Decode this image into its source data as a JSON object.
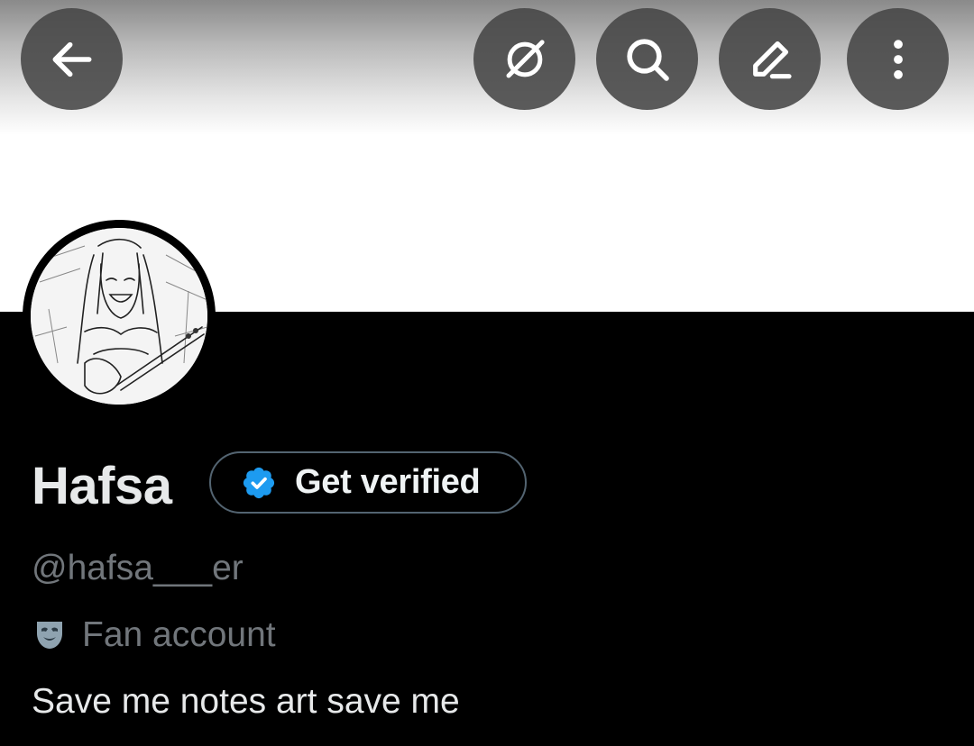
{
  "toolbar": {
    "back_icon": "arrow-left-icon",
    "grok_icon": "grok-icon",
    "search_icon": "search-icon",
    "edit_icon": "pencil-icon",
    "more_icon": "more-vertical-icon"
  },
  "profile": {
    "name": "Hafsa",
    "handle": "@hafsa___er",
    "verify_button_label": "Get verified",
    "verify_badge_color": "#1d9bf0",
    "category_icon": "performing-arts-masks-icon",
    "category": "Fan account",
    "bio": "Save me notes art save me"
  },
  "colors": {
    "background": "#000000",
    "primary_text": "#e7e9ea",
    "secondary_text": "#71767b",
    "verified_blue": "#1d9bf0"
  }
}
